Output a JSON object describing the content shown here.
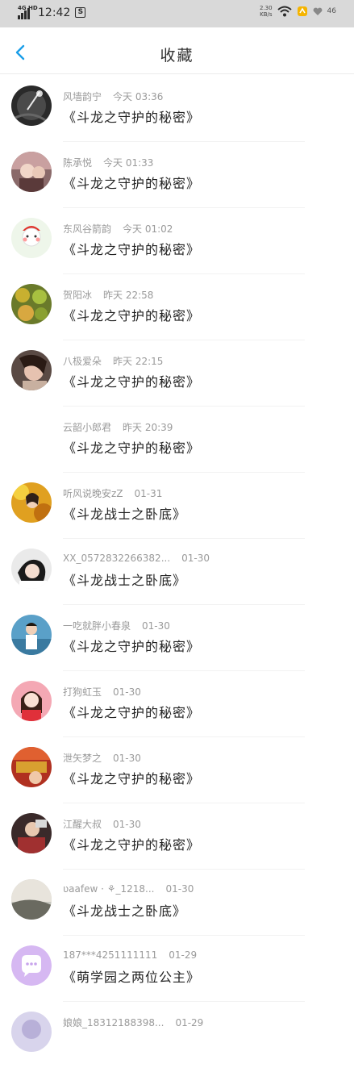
{
  "status": {
    "network": "4G HD",
    "time": "12:42",
    "app_icon": "S",
    "speed_value": "2.30",
    "speed_unit": "KB/s",
    "battery": "46"
  },
  "header": {
    "title": "收藏",
    "back_icon": "chevron-left-icon"
  },
  "colors": {
    "accent": "#1a9ee8",
    "divider": "#f2f2f2"
  },
  "items": [
    {
      "name": "风墙韵宁",
      "time": "今天 03:36",
      "book": "《斗龙之守护的秘密》"
    },
    {
      "name": "陈承悦",
      "time": "今天 01:33",
      "book": "《斗龙之守护的秘密》"
    },
    {
      "name": "东风谷箭韵",
      "time": "今天 01:02",
      "book": "《斗龙之守护的秘密》",
      "avatar_text": "老婆，我生气了"
    },
    {
      "name": "贺阳冰",
      "time": "昨天 22:58",
      "book": "《斗龙之守护的秘密》"
    },
    {
      "name": "八极爱朵",
      "time": "昨天 22:15",
      "book": "《斗龙之守护的秘密》"
    },
    {
      "name": "云韶小郎君",
      "time": "昨天 20:39",
      "book": "《斗龙之守护的秘密》"
    },
    {
      "name": "听风说晚安zZ",
      "time": "01-31",
      "book": "《斗龙战士之卧底》"
    },
    {
      "name": "XX_0572832266382...",
      "time": "01-30",
      "book": "《斗龙战士之卧底》"
    },
    {
      "name": "一吃就胖小春泉",
      "time": "01-30",
      "book": "《斗龙之守护的秘密》"
    },
    {
      "name": "打狗虹玉",
      "time": "01-30",
      "book": "《斗龙之守护的秘密》"
    },
    {
      "name": "泄矢梦之",
      "time": "01-30",
      "book": "《斗龙之守护的秘密》"
    },
    {
      "name": "江醒大叔",
      "time": "01-30",
      "book": "《斗龙之守护的秘密》"
    },
    {
      "name": "ʋaafew · ⚘_1218...",
      "time": "01-30",
      "book": "《斗龙战士之卧底》"
    },
    {
      "name": "187***4251111111",
      "time": "01-29",
      "book": "《萌学园之两位公主》"
    },
    {
      "name": "娘娘_18312188398...",
      "time": "01-29",
      "book": ""
    }
  ]
}
